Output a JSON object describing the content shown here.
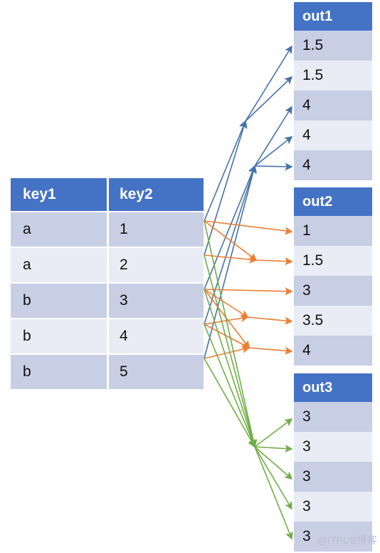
{
  "diagram": {
    "title": "groupby transform fan-out diagram",
    "colors": {
      "header_blue": "#4472C4",
      "row_dark": "#C8CEE4",
      "row_light": "#E9ECF5",
      "arrow_blue": "#4472A8",
      "arrow_orange": "#ED7D31",
      "arrow_green": "#70AD47",
      "text_dark": "#111111"
    }
  },
  "input_table": {
    "name": "key-table",
    "headers": [
      "key1",
      "key2"
    ],
    "rows": [
      {
        "key1": "a",
        "key2": "1"
      },
      {
        "key1": "a",
        "key2": "2"
      },
      {
        "key1": "b",
        "key2": "3"
      },
      {
        "key1": "b",
        "key2": "4"
      },
      {
        "key1": "b",
        "key2": "5"
      }
    ]
  },
  "output_tables": [
    {
      "name": "out1",
      "header": "out1",
      "accent": "#4472A8",
      "values": [
        "1.5",
        "1.5",
        "4",
        "4",
        "4"
      ]
    },
    {
      "name": "out2",
      "header": "out2",
      "accent": "#ED7D31",
      "values": [
        "1",
        "1.5",
        "3",
        "3.5",
        "4"
      ]
    },
    {
      "name": "out3",
      "header": "out3",
      "accent": "#70AD47",
      "values": [
        "3",
        "3",
        "3",
        "3",
        "3"
      ]
    }
  ],
  "watermark": {
    "text": "@ITPUB博客"
  }
}
